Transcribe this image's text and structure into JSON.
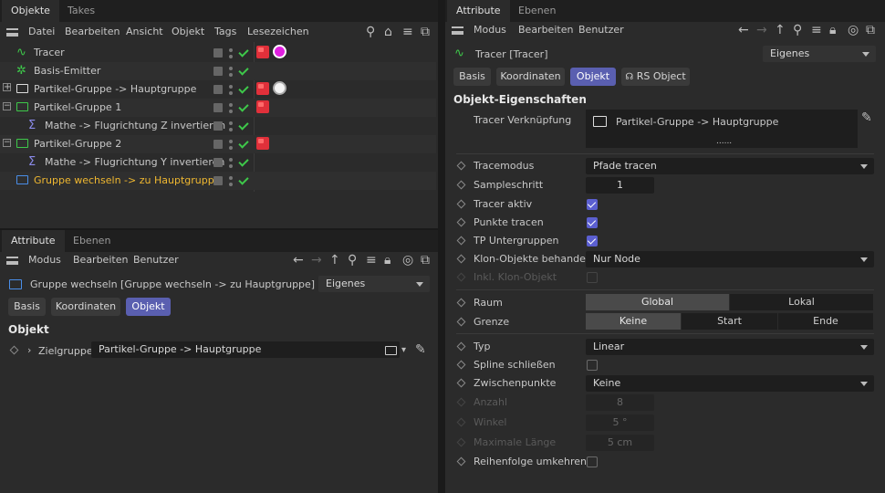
{
  "left_top": {
    "tabs": [
      "Objekte",
      "Takes"
    ],
    "menu": [
      "Datei",
      "Bearbeiten",
      "Ansicht",
      "Objekt",
      "Tags",
      "Lesezeichen"
    ],
    "objects": [
      {
        "label": "Tracer",
        "icon": "tracer-icon",
        "indent": 0,
        "expander": ""
      },
      {
        "label": "Basis-Emitter",
        "icon": "emitter-icon",
        "indent": 0,
        "expander": ""
      },
      {
        "label": "Partikel-Gruppe -> Hauptgruppe",
        "icon": "folder-icon",
        "indent": 0,
        "expander": "+"
      },
      {
        "label": "Partikel-Gruppe 1",
        "icon": "folder-icon",
        "indent": 0,
        "expander": "-"
      },
      {
        "label": "Mathe -> Flugrichtung Z invertieren",
        "icon": "sigma-icon",
        "indent": 1,
        "expander": ""
      },
      {
        "label": "Partikel-Gruppe 2",
        "icon": "folder-icon",
        "indent": 0,
        "expander": "-"
      },
      {
        "label": "Mathe -> Flugrichtung Y invertieren",
        "icon": "sigma-icon",
        "indent": 1,
        "expander": ""
      },
      {
        "label": "Gruppe wechseln -> zu Hauptgruppe",
        "icon": "switch-group-icon",
        "indent": 0,
        "expander": "",
        "highlight": true
      }
    ],
    "highlight_color": "#f0b830"
  },
  "left_bottom": {
    "tabs": [
      "Attribute",
      "Ebenen"
    ],
    "menu": [
      "Modus",
      "Bearbeiten",
      "Benutzer"
    ],
    "title": "Gruppe wechseln [Gruppe wechseln -> zu Hauptgruppe]",
    "preset": "Eigenes",
    "subtabs": [
      "Basis",
      "Koordinaten",
      "Objekt"
    ],
    "section": "Objekt",
    "param_label": "Zielgruppe",
    "param_value": "Partikel-Gruppe -> Hauptgruppe"
  },
  "right": {
    "tabs": [
      "Attribute",
      "Ebenen"
    ],
    "menu": [
      "Modus",
      "Bearbeiten",
      "Benutzer"
    ],
    "title": "Tracer [Tracer]",
    "preset": "Eigenes",
    "subtabs": [
      "Basis",
      "Koordinaten",
      "Objekt",
      "RS Object"
    ],
    "section": "Objekt-Eigenschaften",
    "link_label": "Tracer Verknüpfung",
    "link_value": "Partikel-Gruppe -> Hauptgruppe",
    "link_more": "......",
    "tracemodus_label": "Tracemodus",
    "tracemodus_value": "Pfade tracen",
    "sampleschritt_label": "Sampleschritt",
    "sampleschritt_value": "1",
    "tracer_aktiv_label": "Tracer aktiv",
    "punkte_label": "Punkte tracen",
    "tp_label": "TP Untergruppen",
    "klon_label": "Klon-Objekte behandeln",
    "klon_value": "Nur Node",
    "inkl_label": "Inkl. Klon-Objekt",
    "raum_label": "Raum",
    "raum_options": [
      "Global",
      "Lokal"
    ],
    "grenze_label": "Grenze",
    "grenze_options": [
      "Keine",
      "Start",
      "Ende"
    ],
    "typ_label": "Typ",
    "typ_value": "Linear",
    "spline_label": "Spline schließen",
    "zwischen_label": "Zwischenpunkte",
    "zwischen_value": "Keine",
    "anzahl_label": "Anzahl",
    "anzahl_value": "8",
    "winkel_label": "Winkel",
    "winkel_value": "5 °",
    "maxlen_label": "Maximale Länge",
    "maxlen_value": "5 cm",
    "reihen_label": "Reihenfolge umkehren"
  }
}
